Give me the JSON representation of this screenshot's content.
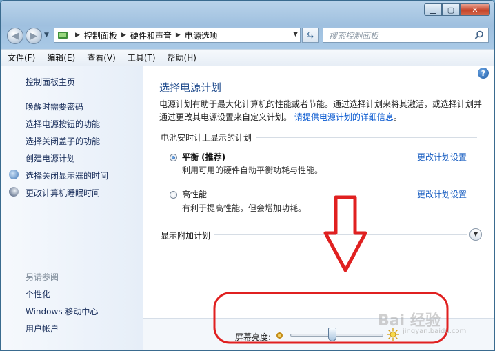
{
  "address": {
    "crumbs": [
      "控制面板",
      "硬件和声音",
      "电源选项"
    ]
  },
  "search": {
    "placeholder": "搜索控制面板"
  },
  "menu": [
    "文件(F)",
    "编辑(E)",
    "查看(V)",
    "工具(T)",
    "帮助(H)"
  ],
  "sidebar": {
    "home": "控制面板主页",
    "links": [
      {
        "label": "唤醒时需要密码",
        "icon": ""
      },
      {
        "label": "选择电源按钮的功能",
        "icon": ""
      },
      {
        "label": "选择关闭盖子的功能",
        "icon": ""
      },
      {
        "label": "创建电源计划",
        "icon": ""
      },
      {
        "label": "选择关闭显示器的时间",
        "icon": "display-icon"
      },
      {
        "label": "更改计算机睡眠时间",
        "icon": "moon-icon"
      }
    ],
    "see_also_head": "另请参阅",
    "see_also": [
      "个性化",
      "Windows 移动中心",
      "用户帐户"
    ]
  },
  "content": {
    "help": "?",
    "title": "选择电源计划",
    "desc_text": "电源计划有助于最大化计算机的性能或者节能。通过选择计划来将其激活，或选择计划并通过更改其电源设置来自定义计划。",
    "desc_link": "请提供电源计划的详细信息",
    "desc_end": "。",
    "section_head": "电池安时计上显示的计划",
    "plans": [
      {
        "name": "平衡 (推荐)",
        "desc": "利用可用的硬件自动平衡功耗与性能。",
        "link": "更改计划设置",
        "selected": true
      },
      {
        "name": "高性能",
        "desc": "有利于提高性能，但会增加功耗。",
        "link": "更改计划设置",
        "selected": false
      }
    ],
    "more_plans": "显示附加计划",
    "brightness_label": "屏幕亮度:",
    "brightness_level": 0.45
  },
  "colors": {
    "annotation": "#e02020",
    "link": "#1a5fc2"
  },
  "watermark": {
    "main": "Bai 经验",
    "sub": "jingyan.baidu.com"
  }
}
